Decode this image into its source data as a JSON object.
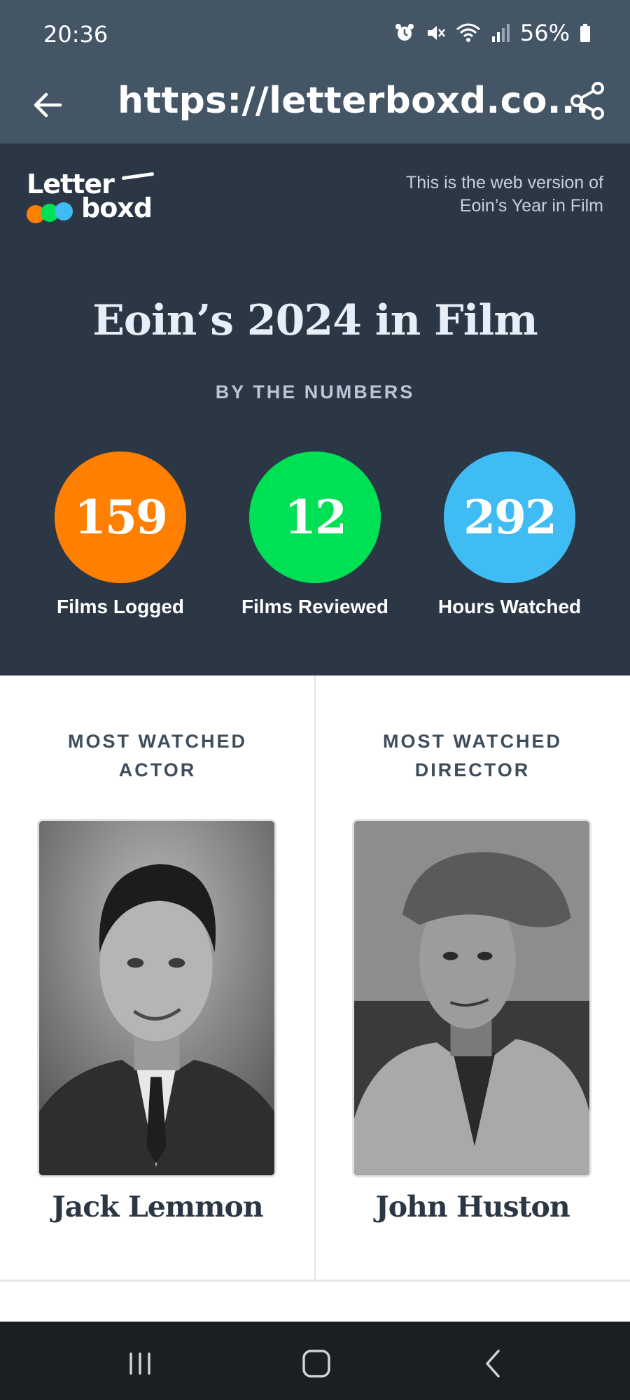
{
  "status_bar": {
    "time": "20:36",
    "battery": "56%",
    "icons": [
      "alarm-icon",
      "mute-icon",
      "wifi-icon",
      "signal-icon",
      "battery-icon"
    ]
  },
  "browser": {
    "url": "https://letterboxd.co...",
    "back_icon": "back-arrow-icon",
    "share_icon": "share-icon"
  },
  "header": {
    "logo_text_top": "Letter",
    "logo_text_bottom": "boxd",
    "web_note_line1": "This is the web version of",
    "web_note_line2": "Eoin’s Year in Film"
  },
  "hero": {
    "title": "Eoin’s 2024 in Film",
    "subtitle": "BY THE NUMBERS"
  },
  "stats": [
    {
      "value": "159",
      "label": "Films Logged",
      "color": "#ff8000"
    },
    {
      "value": "12",
      "label": "Films Reviewed",
      "color": "#00e054"
    },
    {
      "value": "292",
      "label": "Hours Watched",
      "color": "#40bcf4"
    }
  ],
  "most_watched": {
    "actor": {
      "heading_line1": "MOST WATCHED",
      "heading_line2": "ACTOR",
      "name": "Jack Lemmon"
    },
    "director": {
      "heading_line1": "MOST WATCHED",
      "heading_line2": "DIRECTOR",
      "name": "John Huston"
    }
  },
  "nav_bar": {
    "buttons": [
      "recent-apps-icon",
      "home-icon",
      "back-icon"
    ]
  },
  "colors": {
    "browser_bar": "#445566",
    "hero_bg": "#2c3745",
    "nav_bar": "#1b1e23"
  }
}
